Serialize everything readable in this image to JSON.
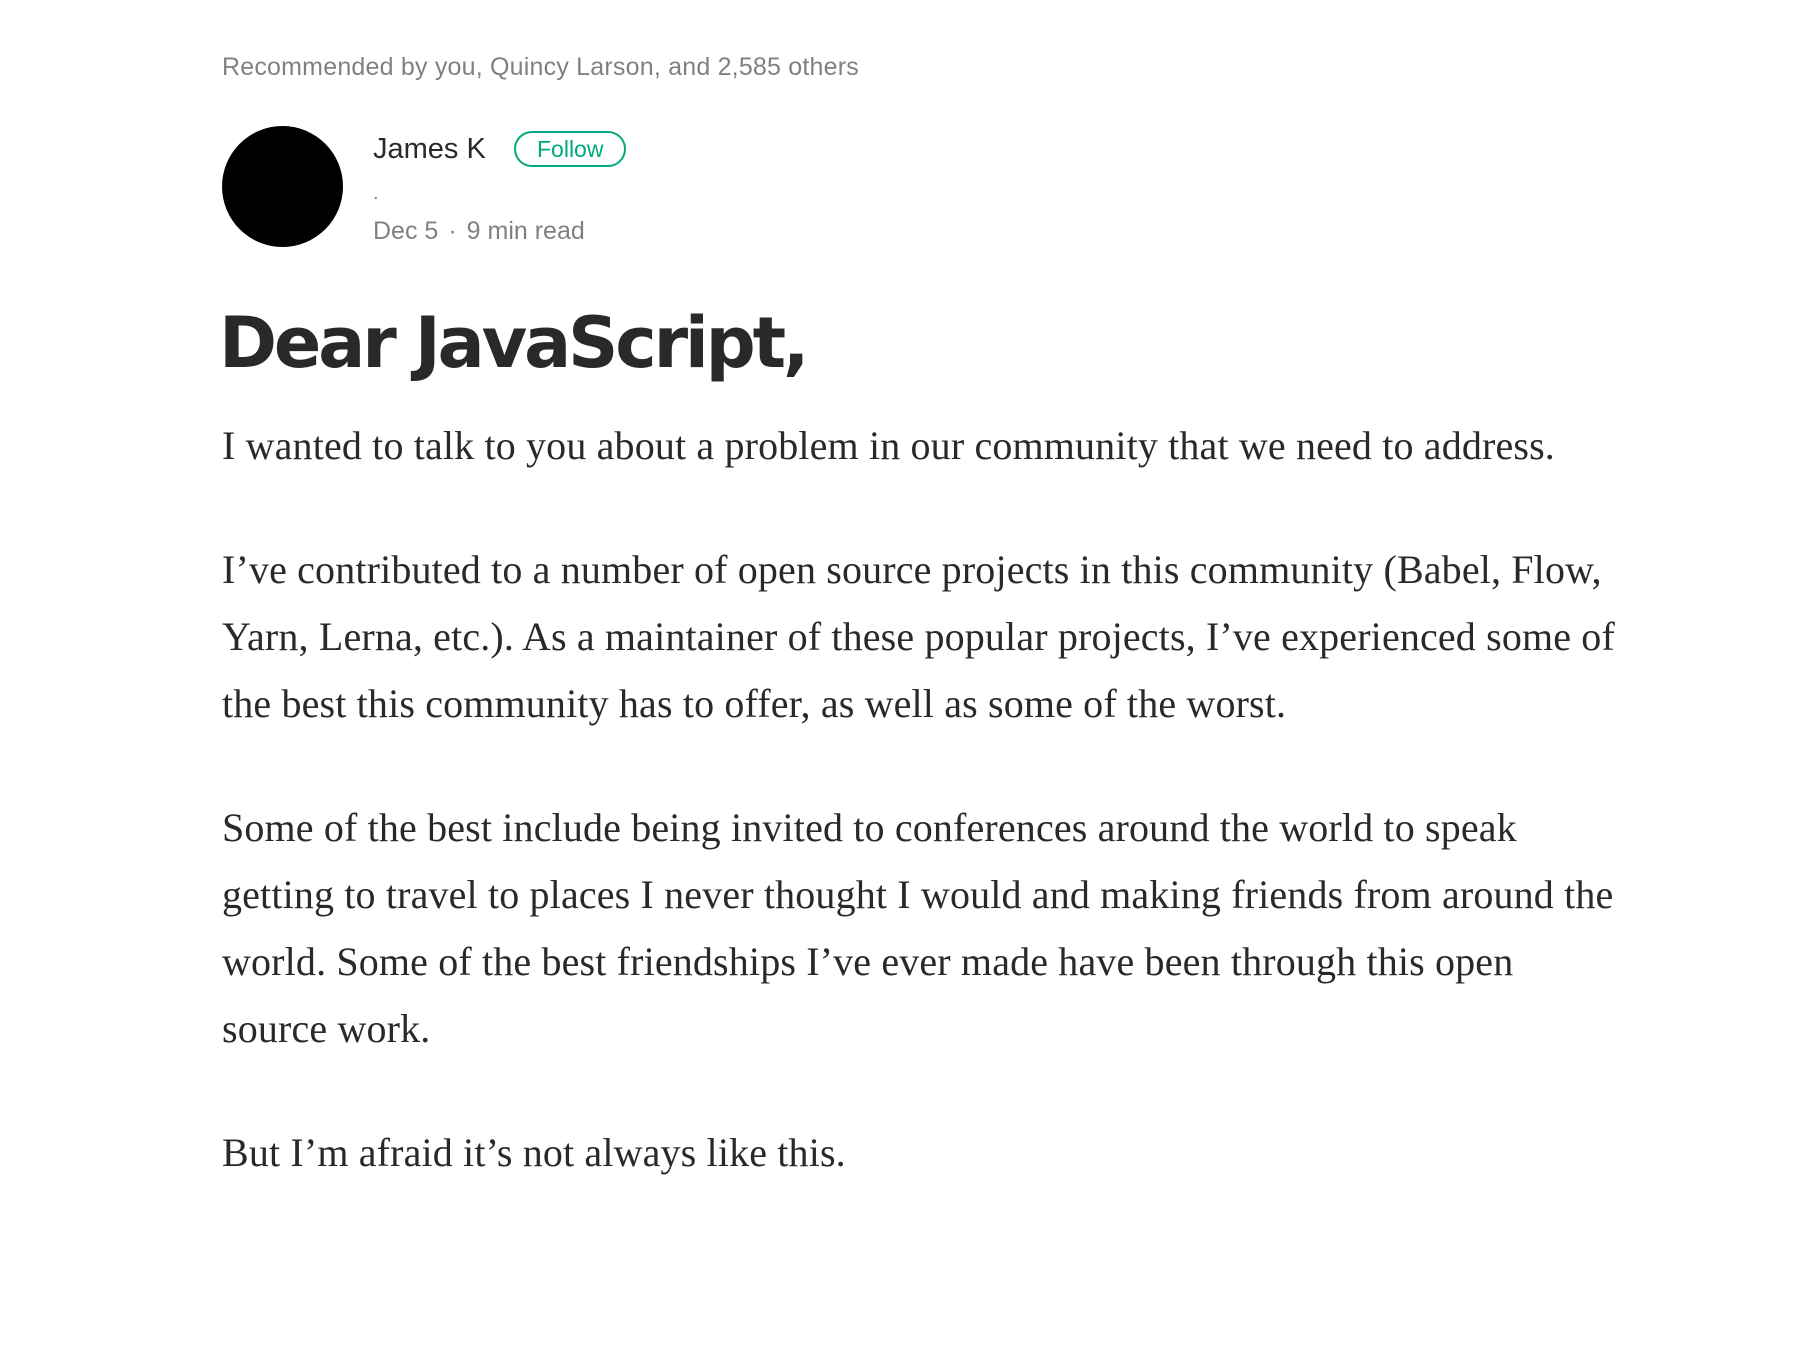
{
  "recommended_text": "Recommended by you, Quincy Larson, and 2,585 others",
  "author": {
    "name": "James K",
    "follow_label": "Follow",
    "bio": ".",
    "date": "Dec 5",
    "separator": "·",
    "read_time": "9 min read"
  },
  "article": {
    "title": "Dear JavaScript,",
    "paragraphs": [
      "I wanted to talk to you about a problem in our community that we need to address.",
      "I’ve contributed to a number of open source projects in this community (Babel, Flow, Yarn, Lerna, etc.). As a maintainer of these popular projects, I’ve experienced some of the best this community has to offer, as well as some of the worst.",
      "Some of the best include being invited to conferences around the world to speak getting to travel to places I never thought I would and making friends from around the world. Some of the best friendships I’ve ever made have been through this open source work.",
      "But I’m afraid it’s not always like this."
    ]
  },
  "colors": {
    "accent": "#03a87c",
    "avatar": "#000000",
    "text": "#262626",
    "muted": "#808080"
  }
}
